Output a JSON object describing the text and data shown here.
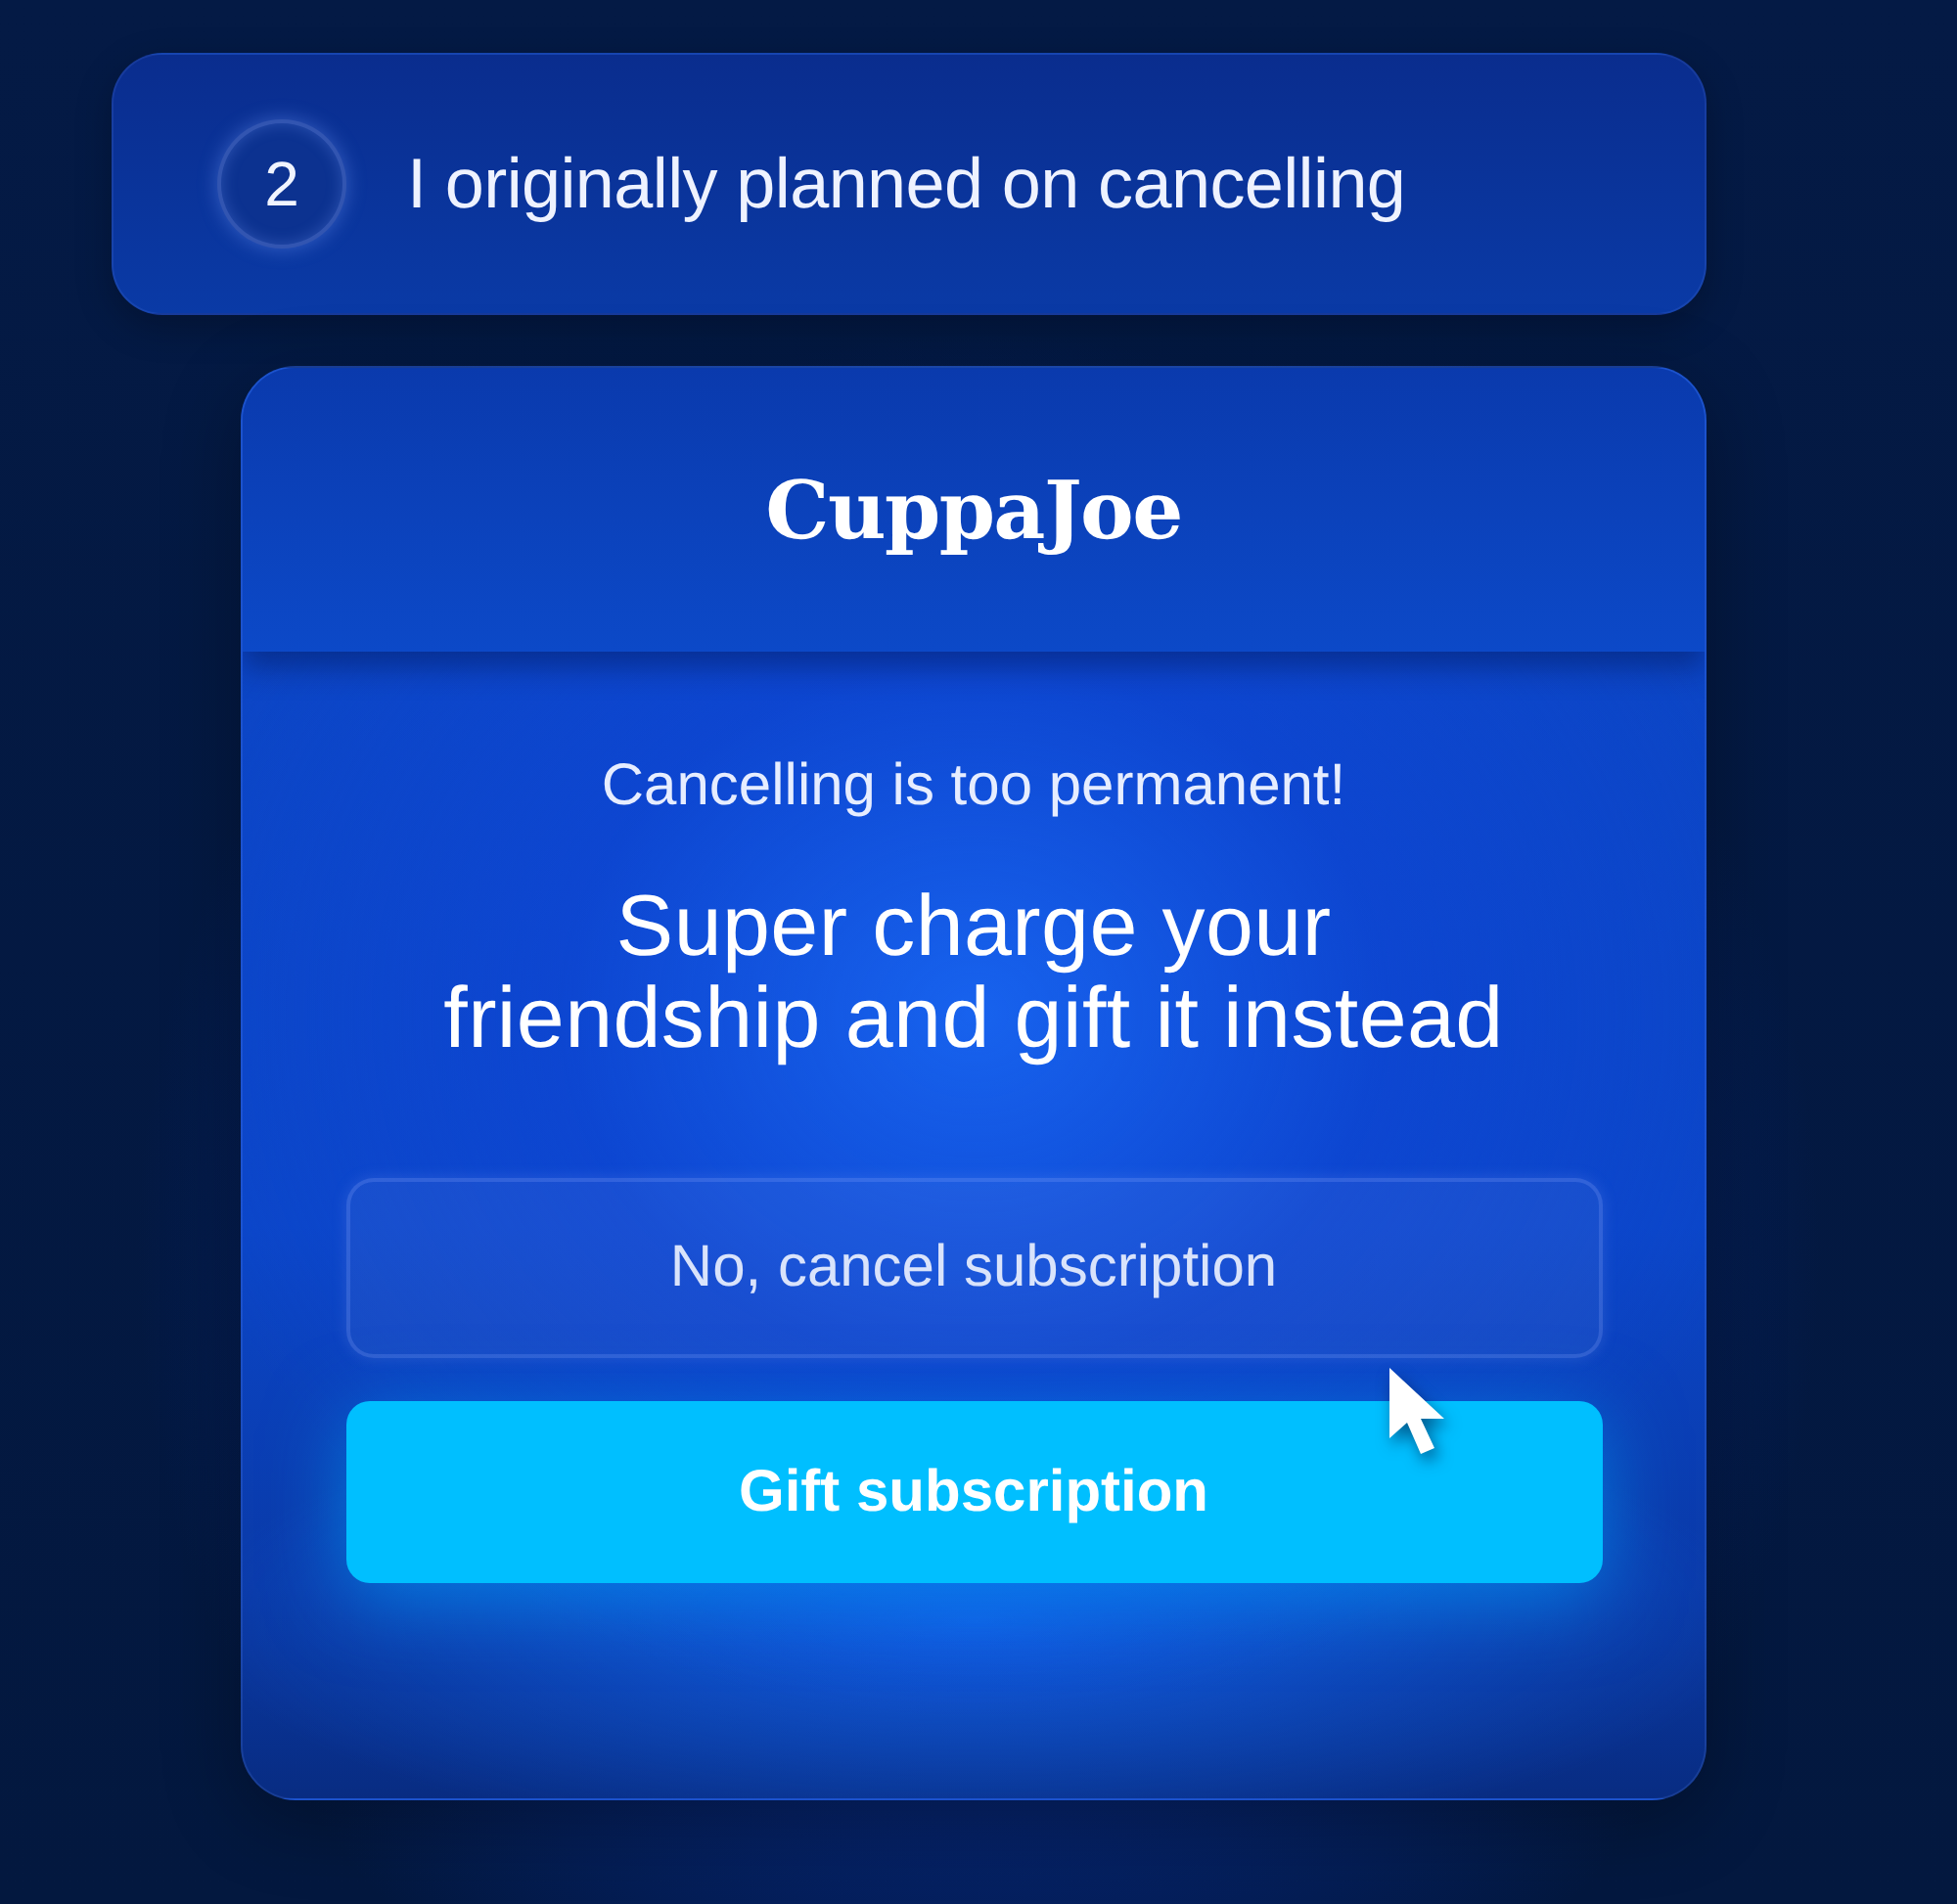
{
  "step": {
    "number": "2",
    "label": "I originally planned on cancelling"
  },
  "card": {
    "brand": "CuppaJoe",
    "subtitle": "Cancelling is too permanent!",
    "heading_lines": [
      "Super charge your",
      "friendship and gift it instead"
    ],
    "buttons": [
      {
        "label": "No, cancel subscription",
        "kind": "secondary"
      },
      {
        "label": "Gift subscription",
        "kind": "primary"
      }
    ]
  }
}
